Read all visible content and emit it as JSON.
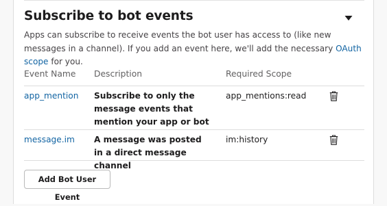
{
  "section": {
    "title": "Subscribe to bot events",
    "intro_before_link": "Apps can subscribe to receive events the bot user has access to (like new messages in a channel). If you add an event here, we'll add the necessary ",
    "intro_link": "OAuth scope",
    "intro_after_link": " for you.",
    "collapse_icon": "caret-down-icon",
    "accent_color": "#1264a3"
  },
  "table": {
    "headers": [
      "Event Name",
      "Description",
      "Required Scope"
    ],
    "rows": [
      {
        "event": "app_mention",
        "description": "Subscribe to only the message events that mention your app or bot",
        "scope": "app_mentions:read",
        "action_icon": "trash-icon"
      },
      {
        "event": "message.im",
        "description": "A message was posted in a direct message channel",
        "scope": "im:history",
        "action_icon": "trash-icon"
      }
    ]
  },
  "add_button_label": "Add Bot User Event"
}
